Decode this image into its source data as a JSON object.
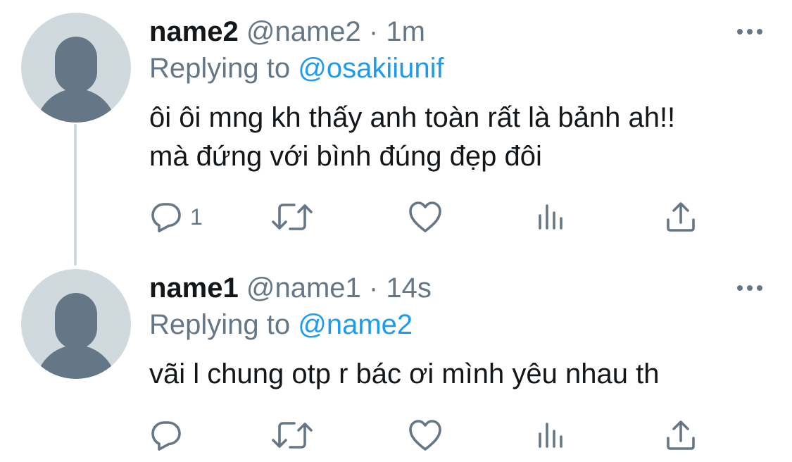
{
  "tweets": [
    {
      "name": "name2",
      "handle": "@name2",
      "separator": "·",
      "time": "1m",
      "replying_prefix": "Replying to",
      "replying_to": "@osakiiunif",
      "text_lines": [
        "ôi ôi mng kh thấy anh toàn rất là bảnh ah!!",
        "mà đứng với bình đúng đẹp đôi"
      ],
      "reply_count": "1",
      "icons": {
        "avatar": "default-avatar-icon",
        "more": "more-dots-icon",
        "reply": "reply-icon",
        "retweet": "retweet-icon",
        "like": "heart-icon",
        "views": "analytics-icon",
        "share": "share-icon"
      }
    },
    {
      "name": "name1",
      "handle": "@name1",
      "separator": "·",
      "time": "14s",
      "replying_prefix": "Replying to",
      "replying_to": "@name2",
      "text_lines": [
        "vãi l chung otp r bác ơi mình yêu nhau th"
      ],
      "reply_count": "",
      "icons": {
        "avatar": "default-avatar-icon",
        "more": "more-dots-icon",
        "reply": "reply-icon",
        "retweet": "retweet-icon",
        "like": "heart-icon",
        "views": "analytics-icon",
        "share": "share-icon"
      }
    }
  ],
  "colors": {
    "text": "#14171a",
    "secondary": "#657786",
    "accent": "#1d9bf0",
    "avatar_bg": "#cfd9de",
    "avatar_fg": "#657786",
    "thread_line": "#cfd9de"
  }
}
